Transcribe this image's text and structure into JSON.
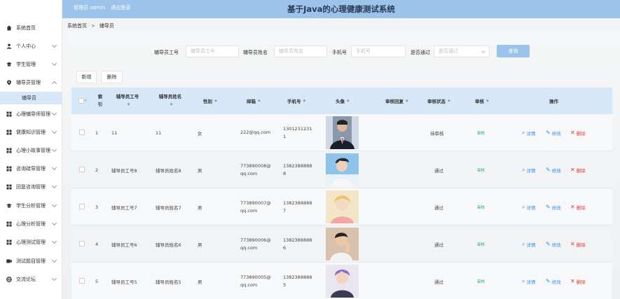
{
  "header": {
    "user_label": "管理员 admin",
    "logout_label": "退出登录",
    "title": "基于Java的心理健康测试系统"
  },
  "sidebar": {
    "items": [
      {
        "label": "系统首页",
        "icon": "home-icon"
      },
      {
        "label": "个人中心",
        "icon": "user-icon"
      },
      {
        "label": "学生管理",
        "icon": "student-icon"
      },
      {
        "label": "辅导员管理",
        "icon": "location-icon"
      },
      {
        "label": "心理辅导师管理",
        "icon": "grid-icon"
      },
      {
        "label": "健康知识管理",
        "icon": "grid-icon"
      },
      {
        "label": "心理小故事管理",
        "icon": "grid-icon"
      },
      {
        "label": "咨询疏导管理",
        "icon": "grid-icon"
      },
      {
        "label": "回复咨询管理",
        "icon": "grid-icon"
      },
      {
        "label": "学生分析管理",
        "icon": "student-icon"
      },
      {
        "label": "心理分析管理",
        "icon": "grid-icon"
      },
      {
        "label": "心理测试管理",
        "icon": "grid-icon"
      },
      {
        "label": "测试题目管理",
        "icon": "video-icon"
      },
      {
        "label": "交流论坛",
        "icon": "globe-icon"
      }
    ],
    "active_sub": "辅导员"
  },
  "breadcrumb": {
    "home": "系统首页",
    "separator": ">",
    "current": "辅导员"
  },
  "search": {
    "emp_no_label": "辅导员工号",
    "emp_no_placeholder": "辅导员工号",
    "name_label": "辅导员姓名",
    "name_placeholder": "辅导员姓名",
    "phone_label": "手机号",
    "phone_placeholder": "手机号",
    "pass_label": "是否通过",
    "pass_placeholder": "是否通过",
    "query_label": "查询"
  },
  "toolbar": {
    "add_label": "新增",
    "delete_label": "删除"
  },
  "table": {
    "columns": {
      "index_1": "索",
      "index_2": "引",
      "emp_no": "辅导员工号",
      "name": "辅导员姓名",
      "gender": "性别",
      "email": "邮箱",
      "phone": "手机号",
      "avatar": "头像",
      "reply": "审核回复",
      "status": "审核状态",
      "audit": "审核",
      "ops": "操作"
    },
    "actions": {
      "detail": "详情",
      "edit": "修改",
      "delete": "删除"
    },
    "rows": [
      {
        "index": "1",
        "emp_no": "11",
        "name": "11",
        "gender": "女",
        "email_1": "222@qq.com",
        "email_2": "",
        "phone_1": "1301231231",
        "phone_2": "1",
        "reply": "",
        "status": "待审核",
        "audit": "审核",
        "avatar_color": "#5a6b8c"
      },
      {
        "index": "2",
        "emp_no": "辅导员工号8",
        "name": "辅导员姓名8",
        "gender": "男",
        "email_1": "773890008@",
        "email_2": "qq.com",
        "phone_1": "1382388888",
        "phone_2": "8",
        "reply": "",
        "status": "通过",
        "audit": "审核",
        "avatar_color": "#7bb3e0"
      },
      {
        "index": "3",
        "emp_no": "辅导员工号7",
        "name": "辅导员姓名7",
        "gender": "男",
        "email_1": "773890007@",
        "email_2": "qq.com",
        "phone_1": "1382388888",
        "phone_2": "7",
        "reply": "",
        "status": "通过",
        "audit": "审核",
        "avatar_color": "#e8c07a"
      },
      {
        "index": "4",
        "emp_no": "辅导员工号6",
        "name": "辅导员姓名6",
        "gender": "男",
        "email_1": "773890006@",
        "email_2": "qq.com",
        "phone_1": "1382388888",
        "phone_2": "6",
        "reply": "",
        "status": "通过",
        "audit": "审核",
        "avatar_color": "#c7a58a"
      },
      {
        "index": "5",
        "emp_no": "辅导员工号5",
        "name": "辅导员姓名5",
        "gender": "男",
        "email_1": "773890005@",
        "email_2": "qq.com",
        "phone_1": "1382388888",
        "phone_2": "5",
        "reply": "",
        "status": "通过",
        "audit": "审核",
        "avatar_color": "#6f5ca8"
      }
    ]
  },
  "colors": {
    "accent": "#9cc3ea",
    "thead": "#d6e7f8",
    "active_sub": "#d7e7f7",
    "audit_green": "#20b070",
    "link_blue": "#3a8ee6",
    "delete_red": "#e23a3a"
  }
}
